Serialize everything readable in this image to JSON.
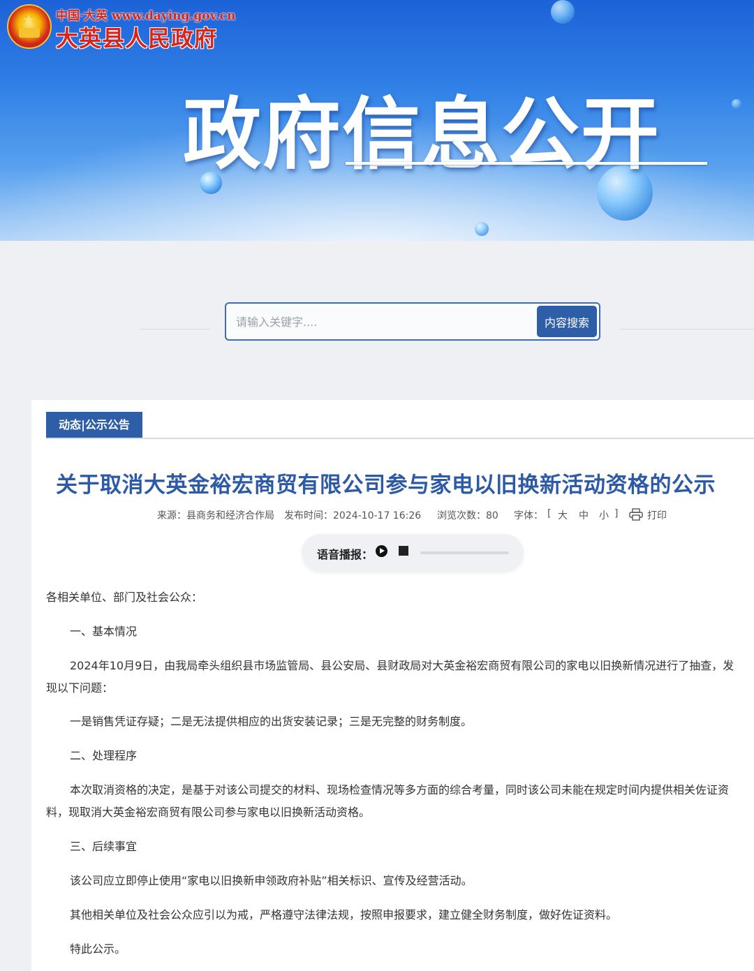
{
  "header": {
    "logo_top": "中国·大英 www.daying.gov.cn",
    "logo_main": "大英县人民政府",
    "banner_title": "政府信息公开"
  },
  "search": {
    "placeholder": "请输入关键字....",
    "button_label": "内容搜索"
  },
  "article": {
    "category_tab": "动态|公示公告",
    "title": "关于取消大英金裕宏商贸有限公司参与家电以旧换新活动资格的公示",
    "meta": {
      "source": "来源：县商务和经济合作局",
      "published": "发布时间：2024-10-17 16:26",
      "views": "浏览次数：80",
      "font_label": "字体：",
      "bracket_open": "[",
      "font_large": "大",
      "font_medium": "中",
      "font_small": "小",
      "bracket_close": "]",
      "print_label": "打印"
    },
    "audio_label": "语音播报：",
    "paragraphs": [
      "各相关单位、部门及社会公众：",
      "一、基本情况",
      "2024年10月9日，由我局牵头组织县市场监管局、县公安局、县财政局对大英金裕宏商贸有限公司的家电以旧换新情况进行了抽查，发",
      "现以下问题：",
      "一是销售凭证存疑；二是无法提供相应的出货安装记录；三是无完整的财务制度。",
      "二、处理程序",
      "本次取消资格的决定，是基于对该公司提交的材料、现场检查情况等多方面的综合考量，同时该公司未能在规定时间内提供相关佐证资",
      "料，现取消大英金裕宏商贸有限公司参与家电以旧换新活动资格。",
      "三、后续事宜",
      "该公司应立即停止使用“家电以旧换新申领政府补贴”相关标识、宣传及经营活动。",
      "其他相关单位及社会公众应引以为戒，严格遵守法律法规，按照申报要求，建立健全财务制度，做好佐证资料。",
      "特此公示。"
    ]
  }
}
